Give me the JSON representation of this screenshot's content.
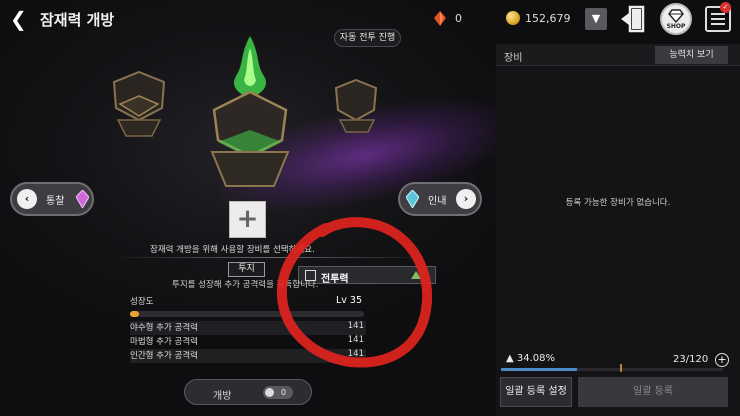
{
  "header": {
    "title": "잠재력 개방",
    "gem_count": "0",
    "gold_count": "152,679",
    "shop_label": "SHOP",
    "menu_badge": "✓"
  },
  "main": {
    "auto_battle_label": "자동 전투 진행",
    "left_nav_label": "통찰",
    "right_nav_label": "인내",
    "hint_text": "잠재력 개방을 위해 사용할 장비를 선택하세요.",
    "selected_tab_label": "투지",
    "power_label": "전투력",
    "description": "투지를 성장해 추가 공격력을 획득합니다.",
    "growth_label": "성장도",
    "growth_level": "Lv 35",
    "growth_fraction": 0.04,
    "stats": [
      {
        "label": "야수형 추가 공격력",
        "value": "141"
      },
      {
        "label": "마법형 추가 공격력",
        "value": "141"
      },
      {
        "label": "인간형 추가 공격력",
        "value": "141"
      }
    ],
    "open_label": "개방",
    "open_toggle_value": "0"
  },
  "equipment_panel": {
    "title": "장비",
    "stats_button": "능력치 보기",
    "empty_message": "등록 가능한 장비가 없습니다.",
    "capacity_percent": "34.08%",
    "capacity_fraction": 0.3408,
    "count": "23/120",
    "bulk_setting_button": "일괄 등록 설정",
    "bulk_register_button": "일괄 등록"
  },
  "colors": {
    "accent_green": "#3fd04a",
    "purple_glow": "#9a3cd2",
    "annotation_red": "#e0241e",
    "growth_orange": "#e9a230",
    "capacity_blue": "#4b8ac6"
  }
}
